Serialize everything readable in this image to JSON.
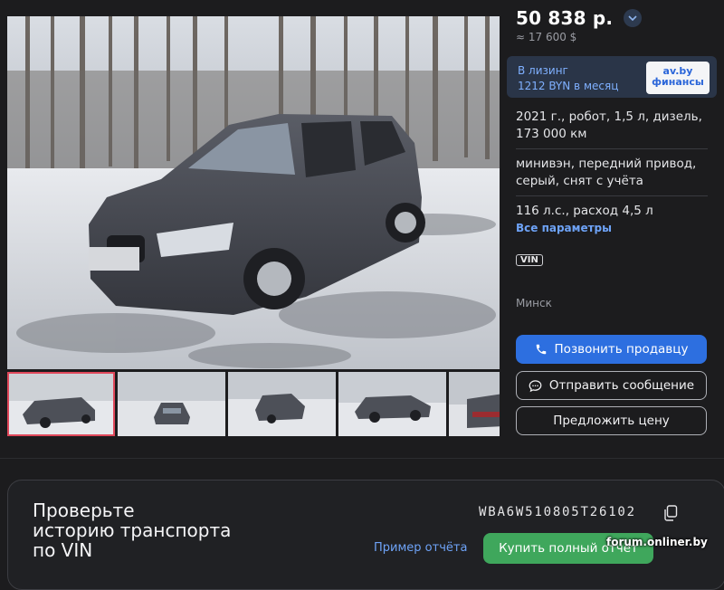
{
  "listing": {
    "price": "50 838 р.",
    "price_usd": "≈ 17 600 $",
    "leasing": {
      "title": "В лизинг",
      "amount": "1212 BYN в месяц",
      "logo_line1": "av.by",
      "logo_line2": "финансы"
    },
    "specs": {
      "line1": "2021 г., робот, 1,5 л, дизель,",
      "line2": "173 000 км",
      "line3": "минивэн, передний привод,",
      "line4": "серый, снят с учёта",
      "line5": "116 л.с., расход 4,5 л"
    },
    "all_params_link": "Все параметры",
    "vin_badge": "VIN",
    "city": "Минск"
  },
  "actions": {
    "call": "Позвонить продавцу",
    "message": "Отправить сообщение",
    "offer": "Предложить цену"
  },
  "vin_check": {
    "title_line1": "Проверьте",
    "title_line2": "историю транспорта",
    "title_line3": "по VIN",
    "vin": "WBA6W510805T26102",
    "report_link": "Пример отчёта",
    "buy_button": "Купить полный отчёт"
  },
  "watermark": "forum.onliner.by",
  "gallery": {
    "thumbnail_count": 5,
    "active_thumbnail": 1
  },
  "colors": {
    "background": "#1c1c1e",
    "primary": "#2d6fe0",
    "link": "#6ea3f7",
    "buy": "#3fa75c",
    "active_thumb_border": "#e0485b",
    "leasing_bg": "#2a3548"
  },
  "icons": [
    "chevron-down-icon",
    "phone-icon",
    "chat-bubble-icon",
    "copy-icon"
  ]
}
